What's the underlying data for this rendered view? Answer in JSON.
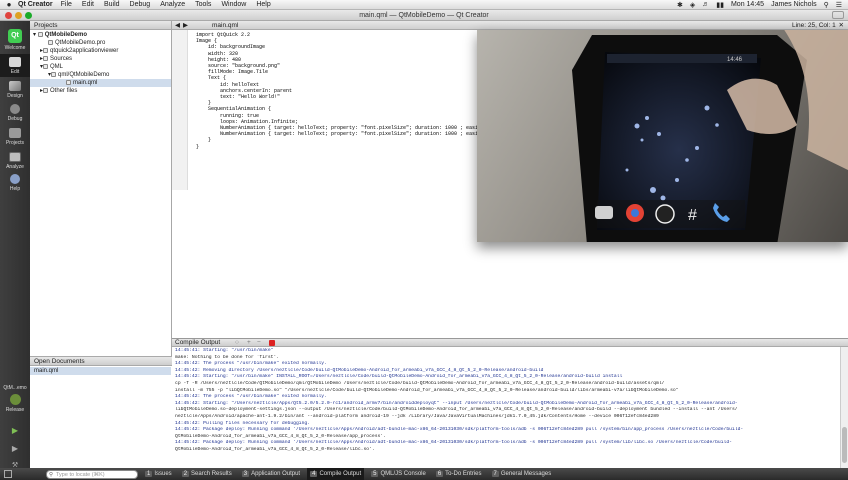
{
  "menubar": {
    "app_name": "Qt Creator",
    "items": [
      "File",
      "Edit",
      "Build",
      "Debug",
      "Analyze",
      "Tools",
      "Window",
      "Help"
    ],
    "clock": "Mon 14:45",
    "user": "James Nichols"
  },
  "window": {
    "title": "main.qml — QtMobileDemo — Qt Creator"
  },
  "modes": [
    {
      "label": "Welcome",
      "icon": "qt-logo-icon"
    },
    {
      "label": "Edit",
      "icon": "edit-icon"
    },
    {
      "label": "Design",
      "icon": "design-icon"
    },
    {
      "label": "Debug",
      "icon": "debug-icon"
    },
    {
      "label": "Projects",
      "icon": "projects-icon"
    },
    {
      "label": "Analyze",
      "icon": "analyze-icon"
    },
    {
      "label": "Help",
      "icon": "help-icon"
    }
  ],
  "kit": {
    "project": "QtM...emo",
    "config": "Release"
  },
  "sidebar": {
    "title": "Projects",
    "tree": [
      "QtMobileDemo",
      "QtMobileDemo.pro",
      "qtquick2applicationviewer",
      "Sources",
      "QML",
      "qml/QtMobileDemo",
      "main.qml",
      "Other files"
    ]
  },
  "open_documents": {
    "title": "Open Documents",
    "items": [
      "main.qml"
    ]
  },
  "editor": {
    "file_name": "main.qml",
    "cursor": "Line: 25, Col: 1",
    "lines": [
      "import QtQuick 2.2",
      "",
      "Image {",
      "    id: backgroundImage",
      "    width: 320",
      "    height: 480",
      "",
      "    source: \"background.png\"",
      "    fillMode: Image.Tile",
      "",
      "    Text {",
      "        id: helloText",
      "        anchors.centerIn: parent",
      "        text: \"Hello World!\"",
      "    }",
      "",
      "    SequentialAnimation {",
      "        running: true",
      "        loops: Animation.Infinite;",
      "        NumberAnimation { target: helloText; property: \"font.pixelSize\"; duration: 1000 ; easing.type: Eas",
      "        NumberAnimation { target: helloText; property: \"font.pixelSize\"; duration: 1000 ; easing.type: Eas",
      "    }",
      "",
      "}"
    ]
  },
  "video": {
    "status_time": "14:46",
    "dock_icons": [
      "camera-icon",
      "chrome-icon",
      "apps-icon",
      "dialer-icon",
      "phone-icon"
    ]
  },
  "compile_output": {
    "title": "Compile Output",
    "lines": [
      "14:45:41: Starting: \"/usr/bin/make\"",
      "make: Nothing to be done for `first'.",
      "14:45:42: The process \"/usr/bin/make\" exited normally.",
      "14:45:42: Removing directory /Users/neztlcle/Code/build-QtMobileDemo-Android_for_armeabi_v7a_GCC_4_8_Qt_5_2_0-Release/android-build",
      "14:45:42: Starting: \"/usr/bin/make\" INSTALL_ROOT=/Users/neztlcle/Code/build-QtMobileDemo-Android_for_armeabi_v7a_GCC_4_8_Qt_5_2_0-Release/android-build install",
      "cp -f -R /Users/neztlcle/Code/QtMobileDemo/qml/QtMobileDemo /Users/neztlcle/Code/build-QtMobileDemo-Android_for_armeabi_v7a_GCC_4_8_Qt_5_2_0-Release/android-build/assets/qml/",
      "install -m 755 -p \"libQtMobileDemo.so\" \"/Users/neztlcle/Code/build-QtMobileDemo-Android_for_armeabi_v7a_GCC_4_8_Qt_5_2_0-Release/android-build/libs/armeabi-v7a/libQtMobileDemo.so\"",
      "14:45:42: The process \"/usr/bin/make\" exited normally.",
      "14:45:42: Starting: \"/Users/neztlcle/Apps/Qt5.2.0/5.2.0-rc1/android_armv7/bin/androiddeployqt\" --input /Users/neztlcle/Code/build-QtMobileDemo-Android_for_armeabi_v7a_GCC_4_8_Qt_5_2_0-Release/android-",
      "libQtMobileDemo.so-deployment-settings.json --output /Users/neztlcle/Code/build-QtMobileDemo-Android_for_armeabi_v7a_GCC_4_8_Qt_5_2_0-Release/android-build --deployment bundled --install --ant /Users/",
      "neztlcle/Apps/Android/apache-ant-1.9.2/bin/ant --android-platform android-19 --jdk /Library/Java/JavaVirtualMachines/jdk1.7.0_45.jdk/Contents/Home --device 006f12efc84ed289",
      "14:45:42: Pulling files necessary for debugging.",
      "14:45:42: Package deploy: Running command '/Users/neztlcle/Apps/Android/adt-bundle-mac-x86_64-20131030/sdk/platform-tools/adb -s 006f12efc84ed289 pull /system/bin/app_process /Users/neztlcle/Code/build-",
      "QtMobileDemo-Android_for_armeabi_v7a_GCC_4_8_Qt_5_2_0-Release/app_process'.",
      "14:45:42: Package deploy: Running command '/Users/neztlcle/Apps/Android/adt-bundle-mac-x86_64-20131030/sdk/platform-tools/adb -s 006f12efc84ed289 pull /system/lib/libc.so /Users/neztlcle/Code/build-",
      "QtMobileDemo-Android_for_armeabi_v7a_GCC_4_8_Qt_5_2_0-Release/libc.so'."
    ]
  },
  "statusbar": {
    "locator_placeholder": "Type to locate (⌘K)",
    "tabs": [
      {
        "num": "1",
        "label": "Issues"
      },
      {
        "num": "2",
        "label": "Search Results"
      },
      {
        "num": "3",
        "label": "Application Output"
      },
      {
        "num": "4",
        "label": "Compile Output"
      },
      {
        "num": "5",
        "label": "QML/JS Console"
      },
      {
        "num": "6",
        "label": "To-Do Entries"
      },
      {
        "num": "7",
        "label": "General Messages"
      }
    ]
  },
  "colors": {
    "accent": "#41cd52",
    "selection": "#cfdcec",
    "output_text": "#1b2f8f"
  }
}
